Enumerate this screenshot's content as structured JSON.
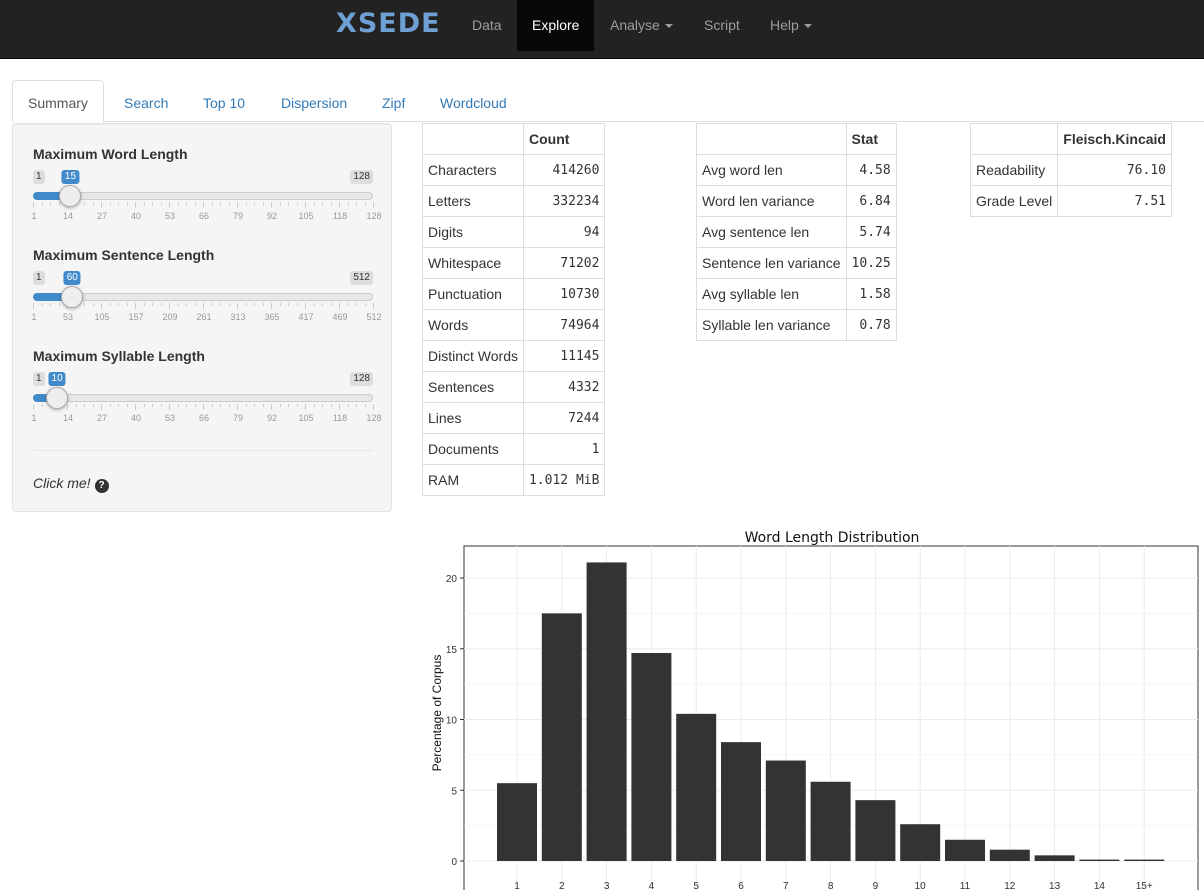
{
  "navbar": {
    "brand": "XSEDE",
    "items": [
      {
        "label": "Data",
        "active": false,
        "dropdown": false
      },
      {
        "label": "Explore",
        "active": true,
        "dropdown": false
      },
      {
        "label": "Analyse",
        "active": false,
        "dropdown": true
      },
      {
        "label": "Script",
        "active": false,
        "dropdown": false
      },
      {
        "label": "Help",
        "active": false,
        "dropdown": true
      }
    ]
  },
  "tabs": [
    {
      "label": "Summary",
      "active": true
    },
    {
      "label": "Search",
      "active": false
    },
    {
      "label": "Top 10",
      "active": false
    },
    {
      "label": "Dispersion",
      "active": false
    },
    {
      "label": "Zipf",
      "active": false
    },
    {
      "label": "Wordcloud",
      "active": false
    }
  ],
  "sidebar": {
    "sliders": [
      {
        "label": "Maximum Word Length",
        "min": 1,
        "max": 128,
        "value": 15,
        "ticks": [
          "1",
          "14",
          "27",
          "40",
          "53",
          "66",
          "79",
          "92",
          "105",
          "118",
          "128"
        ]
      },
      {
        "label": "Maximum Sentence Length",
        "min": 1,
        "max": 512,
        "value": 60,
        "ticks": [
          "1",
          "53",
          "105",
          "157",
          "209",
          "261",
          "313",
          "365",
          "417",
          "469",
          "512"
        ]
      },
      {
        "label": "Maximum Syllable Length",
        "min": 1,
        "max": 128,
        "value": 10,
        "ticks": [
          "1",
          "14",
          "27",
          "40",
          "53",
          "66",
          "79",
          "92",
          "105",
          "118",
          "128"
        ]
      }
    ],
    "click_me": "Click me!",
    "help_icon": "question-circle-icon"
  },
  "count_table": {
    "header": [
      "",
      "Count"
    ],
    "rows": [
      [
        "Characters",
        "414260"
      ],
      [
        "Letters",
        "332234"
      ],
      [
        "Digits",
        "94"
      ],
      [
        "Whitespace",
        "71202"
      ],
      [
        "Punctuation",
        "10730"
      ],
      [
        "Words",
        "74964"
      ],
      [
        "Distinct Words",
        "11145"
      ],
      [
        "Sentences",
        "4332"
      ],
      [
        "Lines",
        "7244"
      ],
      [
        "Documents",
        "1"
      ],
      [
        "RAM",
        "1.012 MiB"
      ]
    ]
  },
  "stat_table": {
    "header": [
      "",
      "Stat"
    ],
    "rows": [
      [
        "Avg word len",
        "4.58"
      ],
      [
        "Word len variance",
        "6.84"
      ],
      [
        "Avg sentence len",
        "5.74"
      ],
      [
        "Sentence len variance",
        "10.25"
      ],
      [
        "Avg syllable len",
        "1.58"
      ],
      [
        "Syllable len variance",
        "0.78"
      ]
    ]
  },
  "fk_table": {
    "header": [
      "",
      "Fleisch.Kincaid"
    ],
    "rows": [
      [
        "Readability",
        "76.10"
      ],
      [
        "Grade Level",
        "7.51"
      ]
    ]
  },
  "chart_data": {
    "type": "bar",
    "title": "Word Length Distribution",
    "xlabel": "",
    "ylabel": "Percentage of Corpus",
    "categories": [
      "1",
      "2",
      "3",
      "4",
      "5",
      "6",
      "7",
      "8",
      "9",
      "10",
      "11",
      "12",
      "13",
      "14",
      "15+"
    ],
    "values": [
      5.5,
      17.5,
      21.1,
      14.7,
      10.4,
      8.4,
      7.1,
      5.6,
      4.3,
      2.6,
      1.5,
      0.8,
      0.4,
      0.1,
      0.1
    ],
    "ylim": [
      0,
      22
    ],
    "yticks": [
      0,
      5,
      10,
      15,
      20
    ],
    "grid": true,
    "bar_color": "#333333",
    "panel_bg": "#ffffff",
    "grid_color": "#ebebeb"
  }
}
